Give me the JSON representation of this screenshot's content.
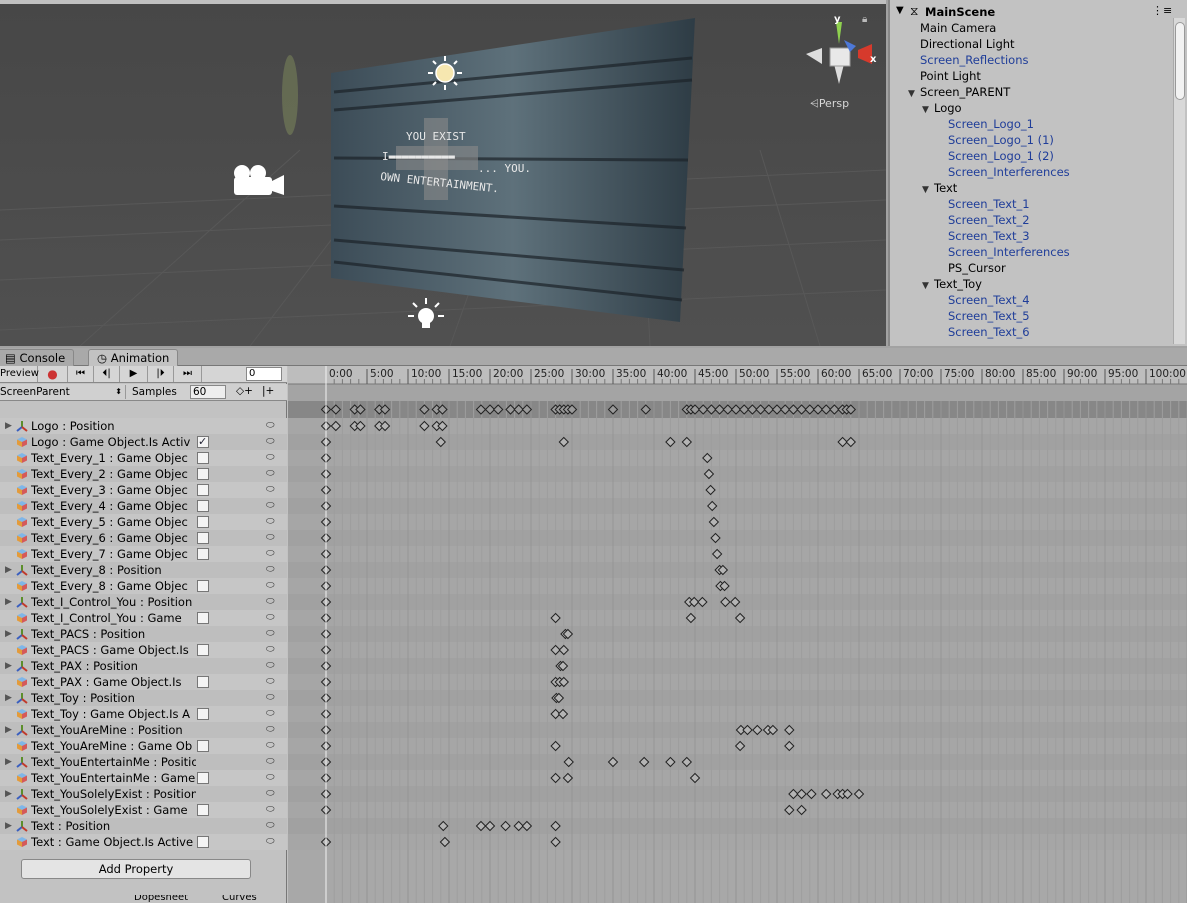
{
  "scene": {
    "gizmo": {
      "y_label": "y",
      "x_label": "x"
    },
    "persp_label": "Persp",
    "screen_text": [
      "YOU EXIST",
      "... YOU.",
      "OWN ENTERTAINMENT."
    ],
    "icons": [
      "sun-icon",
      "camera-icon",
      "light-bulb-icon",
      "lock-icon"
    ]
  },
  "hierarchy": {
    "root": "MainScene",
    "items": [
      {
        "label": "Main Camera",
        "depth": 0,
        "arrow": "",
        "blue": false
      },
      {
        "label": "Directional Light",
        "depth": 0,
        "arrow": "",
        "blue": false
      },
      {
        "label": "Screen_Reflections",
        "depth": 0,
        "arrow": "",
        "blue": true
      },
      {
        "label": "Point Light",
        "depth": 0,
        "arrow": "",
        "blue": false
      },
      {
        "label": "Screen_PARENT",
        "depth": 0,
        "arrow": "▼",
        "blue": false
      },
      {
        "label": "Logo",
        "depth": 1,
        "arrow": "▼",
        "blue": false
      },
      {
        "label": "Screen_Logo_1",
        "depth": 2,
        "arrow": "",
        "blue": true
      },
      {
        "label": "Screen_Logo_1 (1)",
        "depth": 2,
        "arrow": "",
        "blue": true
      },
      {
        "label": "Screen_Logo_1 (2)",
        "depth": 2,
        "arrow": "",
        "blue": true
      },
      {
        "label": "Screen_Interferences",
        "depth": 2,
        "arrow": "",
        "blue": true
      },
      {
        "label": "Text",
        "depth": 1,
        "arrow": "▼",
        "blue": false
      },
      {
        "label": "Screen_Text_1",
        "depth": 2,
        "arrow": "",
        "blue": true
      },
      {
        "label": "Screen_Text_2",
        "depth": 2,
        "arrow": "",
        "blue": true
      },
      {
        "label": "Screen_Text_3",
        "depth": 2,
        "arrow": "",
        "blue": true
      },
      {
        "label": "Screen_Interferences",
        "depth": 2,
        "arrow": "",
        "blue": true
      },
      {
        "label": "PS_Cursor",
        "depth": 2,
        "arrow": "",
        "blue": false
      },
      {
        "label": "Text_Toy",
        "depth": 1,
        "arrow": "▼",
        "blue": false
      },
      {
        "label": "Screen_Text_4",
        "depth": 2,
        "arrow": "",
        "blue": true
      },
      {
        "label": "Screen_Text_5",
        "depth": 2,
        "arrow": "",
        "blue": true
      },
      {
        "label": "Screen_Text_6",
        "depth": 2,
        "arrow": "",
        "blue": true
      }
    ]
  },
  "tabs": {
    "console": "Console",
    "animation": "Animation"
  },
  "animation": {
    "preview_label": "Preview",
    "frame": "0",
    "clip": "ScreenParent",
    "samples_label": "Samples",
    "samples": "60",
    "add_property": "Add Property",
    "bottom_tabs": [
      "Dopesheet",
      "Curves"
    ],
    "time_labels": [
      "0:00",
      "5:00",
      "10:00",
      "15:00",
      "20:00",
      "25:00",
      "30:00",
      "35:00",
      "40:00",
      "45:00",
      "50:00",
      "55:00",
      "60:00",
      "65:00",
      "70:00",
      "75:00",
      "80:00",
      "85:00",
      "90:00",
      "95:00",
      "100:00"
    ],
    "properties": [
      {
        "label": "Logo : Position",
        "kind": "pos",
        "checkbox": false,
        "checked": false,
        "foldout": true,
        "keys": [
          0,
          1.2,
          3.5,
          4.2,
          6.5,
          7.2,
          12,
          13.5,
          14.2
        ]
      },
      {
        "label": "Logo : Game Object.Is Activ",
        "kind": "go",
        "checkbox": true,
        "checked": true,
        "foldout": false,
        "keys": [
          0,
          14,
          29,
          42,
          44,
          63,
          64
        ]
      },
      {
        "label": "Text_Every_1 : Game Objec",
        "kind": "go",
        "checkbox": true,
        "checked": false,
        "foldout": false,
        "keys": [
          0,
          46.5
        ]
      },
      {
        "label": "Text_Every_2 : Game Objec",
        "kind": "go",
        "checkbox": true,
        "checked": false,
        "foldout": false,
        "keys": [
          0,
          46.7
        ]
      },
      {
        "label": "Text_Every_3 : Game Objec",
        "kind": "go",
        "checkbox": true,
        "checked": false,
        "foldout": false,
        "keys": [
          0,
          46.9
        ]
      },
      {
        "label": "Text_Every_4 : Game Objec",
        "kind": "go",
        "checkbox": true,
        "checked": false,
        "foldout": false,
        "keys": [
          0,
          47.1
        ]
      },
      {
        "label": "Text_Every_5 : Game Objec",
        "kind": "go",
        "checkbox": true,
        "checked": false,
        "foldout": false,
        "keys": [
          0,
          47.3
        ]
      },
      {
        "label": "Text_Every_6 : Game Objec",
        "kind": "go",
        "checkbox": true,
        "checked": false,
        "foldout": false,
        "keys": [
          0,
          47.5
        ]
      },
      {
        "label": "Text_Every_7 : Game Objec",
        "kind": "go",
        "checkbox": true,
        "checked": false,
        "foldout": false,
        "keys": [
          0,
          47.7
        ]
      },
      {
        "label": "Text_Every_8 : Position",
        "kind": "pos",
        "checkbox": false,
        "checked": false,
        "foldout": true,
        "keys": [
          0,
          48,
          48.4
        ]
      },
      {
        "label": "Text_Every_8 : Game Objec",
        "kind": "go",
        "checkbox": true,
        "checked": false,
        "foldout": false,
        "keys": [
          0,
          48.1,
          48.6
        ]
      },
      {
        "label": "Text_I_Control_You : Position",
        "kind": "pos",
        "checkbox": false,
        "checked": false,
        "foldout": true,
        "keys": [
          0,
          44.3,
          44.9,
          45.9,
          48.7,
          49.9
        ]
      },
      {
        "label": "Text_I_Control_You : Game",
        "kind": "go",
        "checkbox": true,
        "checked": false,
        "foldout": false,
        "keys": [
          0,
          28,
          44.5,
          50.5
        ]
      },
      {
        "label": "Text_PACS : Position",
        "kind": "pos",
        "checkbox": false,
        "checked": false,
        "foldout": true,
        "keys": [
          0,
          29.2,
          29.5
        ]
      },
      {
        "label": "Text_PACS : Game Object.Is",
        "kind": "go",
        "checkbox": true,
        "checked": false,
        "foldout": false,
        "keys": [
          0,
          28,
          29
        ]
      },
      {
        "label": "Text_PAX : Position",
        "kind": "pos",
        "checkbox": false,
        "checked": false,
        "foldout": true,
        "keys": [
          0,
          28.6,
          28.9
        ]
      },
      {
        "label": "Text_PAX : Game Object.Is",
        "kind": "go",
        "checkbox": true,
        "checked": false,
        "foldout": false,
        "keys": [
          0,
          28,
          28.5,
          29
        ]
      },
      {
        "label": "Text_Toy : Position",
        "kind": "pos",
        "checkbox": false,
        "checked": false,
        "foldout": true,
        "keys": [
          0,
          28.1,
          28.4
        ]
      },
      {
        "label": "Text_Toy : Game Object.Is A",
        "kind": "go",
        "checkbox": true,
        "checked": false,
        "foldout": false,
        "keys": [
          0,
          28,
          28.9
        ]
      },
      {
        "label": "Text_YouAreMine : Position",
        "kind": "pos",
        "checkbox": false,
        "checked": false,
        "foldout": true,
        "keys": [
          0,
          50.6,
          51.4,
          52.6,
          53.9,
          54.5,
          56.5
        ]
      },
      {
        "label": "Text_YouAreMine : Game Ob",
        "kind": "go",
        "checkbox": true,
        "checked": false,
        "foldout": false,
        "keys": [
          0,
          28,
          50.5,
          56.5
        ]
      },
      {
        "label": "Text_YouEntertainMe : Position",
        "kind": "pos",
        "checkbox": false,
        "checked": false,
        "foldout": true,
        "keys": [
          0,
          29.6,
          35,
          38.8,
          42,
          44
        ]
      },
      {
        "label": "Text_YouEntertainMe : Game",
        "kind": "go",
        "checkbox": true,
        "checked": false,
        "foldout": false,
        "keys": [
          0,
          28,
          29.5,
          45
        ]
      },
      {
        "label": "Text_YouSolelyExist : Position",
        "kind": "pos",
        "checkbox": false,
        "checked": false,
        "foldout": true,
        "keys": [
          0,
          57,
          58,
          59.2,
          61,
          62.4,
          63,
          63.6,
          65
        ]
      },
      {
        "label": "Text_YouSolelyExist : Game",
        "kind": "go",
        "checkbox": true,
        "checked": false,
        "foldout": false,
        "keys": [
          0,
          56.5,
          58
        ]
      },
      {
        "label": "Text : Position",
        "kind": "pos",
        "checkbox": false,
        "checked": false,
        "foldout": true,
        "keys": [
          14.3,
          18.9,
          20,
          21.9,
          23.5,
          24.5,
          28
        ]
      },
      {
        "label": "Text : Game Object.Is Active",
        "kind": "go",
        "checkbox": true,
        "checked": false,
        "foldout": false,
        "keys": [
          0,
          14.5,
          28
        ]
      }
    ],
    "summary_keys": [
      0,
      1.2,
      3.5,
      4.2,
      6.5,
      7.2,
      12,
      13.5,
      14.2,
      18.9,
      20,
      21,
      22.5,
      23.5,
      24.5,
      28,
      28.5,
      29,
      29.5,
      30,
      35,
      39,
      44,
      44.5,
      45,
      46,
      47,
      48,
      49,
      50,
      51,
      52,
      53,
      54,
      55,
      56,
      57,
      58,
      59,
      60,
      61,
      62,
      63,
      63.5,
      64
    ]
  }
}
